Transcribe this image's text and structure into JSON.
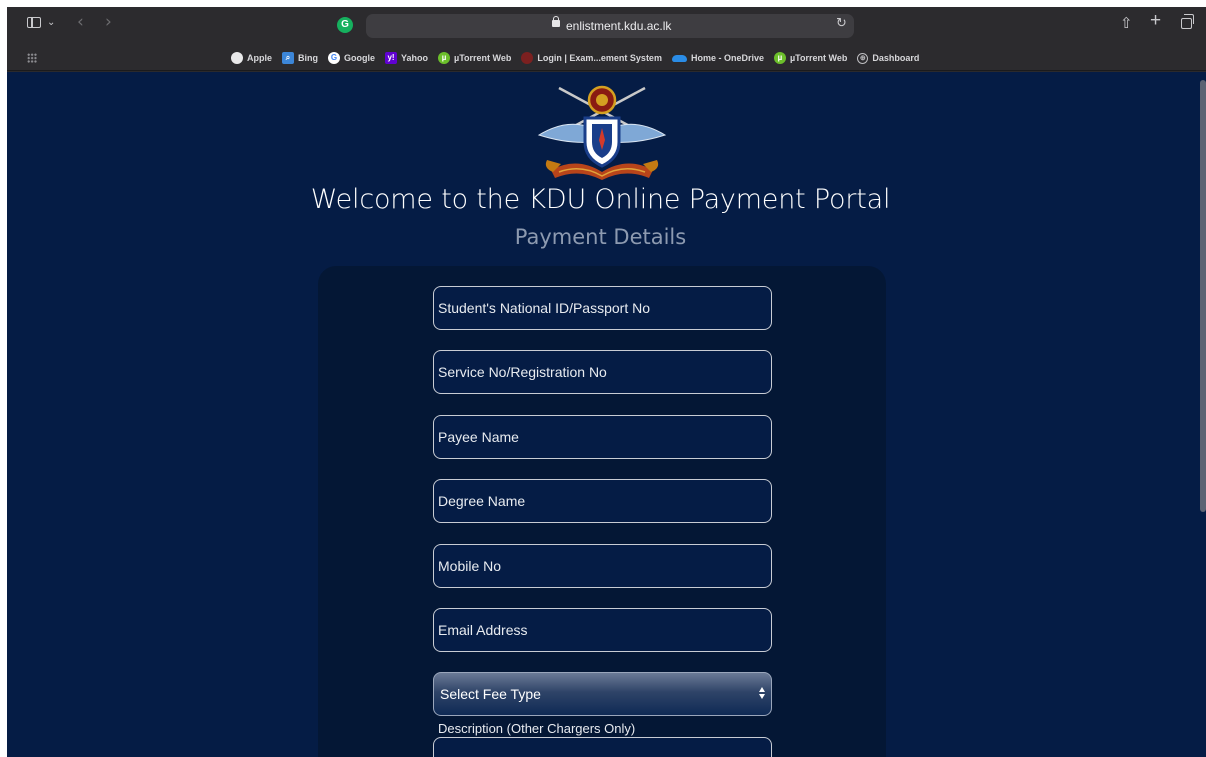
{
  "browser": {
    "url": "enlistment.kdu.ac.lk",
    "bookmarks": [
      {
        "label": "Apple",
        "icon": "apple-icon"
      },
      {
        "label": "Bing",
        "icon": "bing-icon"
      },
      {
        "label": "Google",
        "icon": "google-icon"
      },
      {
        "label": "Yahoo",
        "icon": "yahoo-icon"
      },
      {
        "label": "µTorrent Web",
        "icon": "utorrent-icon"
      },
      {
        "label": "Login | Exam...ement System",
        "icon": "login-icon"
      },
      {
        "label": "Home - OneDrive",
        "icon": "onedrive-icon"
      },
      {
        "label": "µTorrent Web",
        "icon": "utorrent-icon"
      },
      {
        "label": "Dashboard",
        "icon": "globe-icon"
      }
    ]
  },
  "page": {
    "title": "Welcome to the KDU Online Payment Portal",
    "subtitle": "Payment Details",
    "fields": {
      "nic_placeholder": "Student's National ID/Passport No",
      "service_no_placeholder": "Service No/Registration No",
      "payee_name_placeholder": "Payee Name",
      "degree_name_placeholder": "Degree Name",
      "mobile_placeholder": "Mobile No",
      "email_placeholder": "Email Address"
    },
    "fee_type": {
      "selected": "Select Fee Type"
    },
    "description_label": "Description (Other Chargers Only)"
  },
  "colors": {
    "page_background": "#051c45",
    "card_background": "#041735",
    "field_border": "#c8ccd4"
  }
}
